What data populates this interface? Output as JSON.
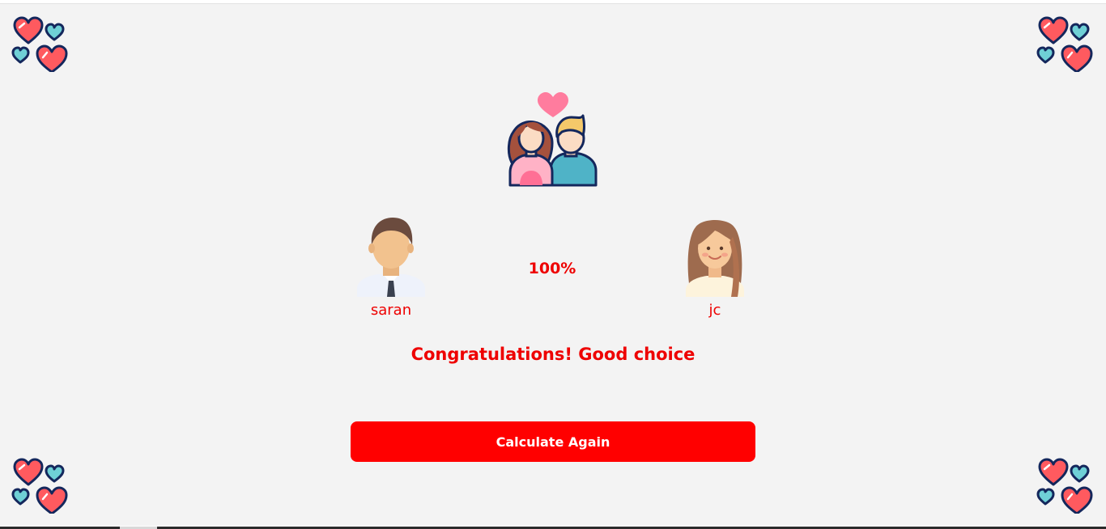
{
  "result": {
    "percentage": "100%",
    "message": "Congratulations! Good choice"
  },
  "persons": {
    "left": {
      "name": "saran",
      "avatar": "male-avatar"
    },
    "right": {
      "name": "jc",
      "avatar": "female-avatar"
    }
  },
  "actions": {
    "calculate_again_label": "Calculate Again"
  },
  "icons": {
    "top": "couple-heart-icon",
    "corners": "hearts-icon"
  },
  "colors": {
    "accent": "#ff0000",
    "text_accent": "#ee0000",
    "background": "#f3f3f3",
    "heart_red": "#ff5a5f",
    "heart_teal": "#6fd0d6",
    "outline_navy": "#14275c"
  }
}
